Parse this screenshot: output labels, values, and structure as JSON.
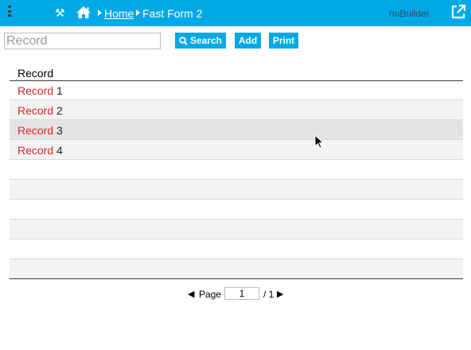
{
  "topbar": {
    "menu_icon": "vertical-dots-icon",
    "tools_icon": "tools-icon",
    "home_icon": "home-icon",
    "breadcrumb_home": "Home",
    "breadcrumb_current": "Fast Form 2",
    "brand": "nuBuilder",
    "popout_icon": "external-link-icon",
    "bg_color": "#00a9e6"
  },
  "toolbar": {
    "search_placeholder": "Record",
    "search_value": "",
    "search_label": "Search",
    "add_label": "Add",
    "print_label": "Print"
  },
  "grid": {
    "column_header": "Record",
    "rows": [
      {
        "word": "Record",
        "num": "1"
      },
      {
        "word": "Record",
        "num": "2"
      },
      {
        "word": "Record",
        "num": "3"
      },
      {
        "word": "Record",
        "num": "4"
      }
    ],
    "highlight_color": "#d7262b"
  },
  "pager": {
    "prev_symbol": "◀",
    "label": "Page",
    "current": "1",
    "total": "/ 1",
    "next_symbol": "▶"
  }
}
